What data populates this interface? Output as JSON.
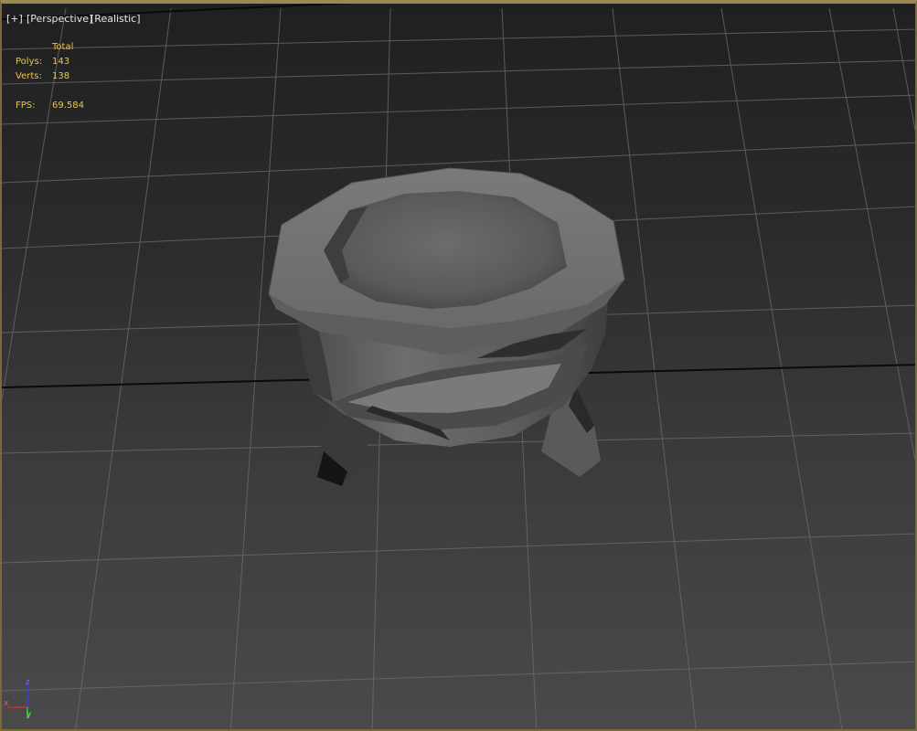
{
  "viewport": {
    "labels": {
      "menu": "[+]",
      "view": "[Perspective]",
      "shading": "[Realistic]"
    },
    "stats": {
      "header": "Total",
      "polys_label": "Polys:",
      "polys_value": "143",
      "verts_label": "Verts:",
      "verts_value": "138",
      "fps_label": "FPS:",
      "fps_value": "69.584"
    },
    "gizmo": {
      "z": "z",
      "x": "x",
      "y": "y"
    },
    "colors": {
      "stats_text": "#e8c84a",
      "viewport_border": "#9a8a52",
      "grid_line": "#6e6e6e",
      "grid_axis": "#0a0a0a",
      "axis_x": "#c83232",
      "axis_y": "#32c832",
      "axis_z": "#3c3cdc"
    },
    "object_name": "mortar-bowl"
  }
}
